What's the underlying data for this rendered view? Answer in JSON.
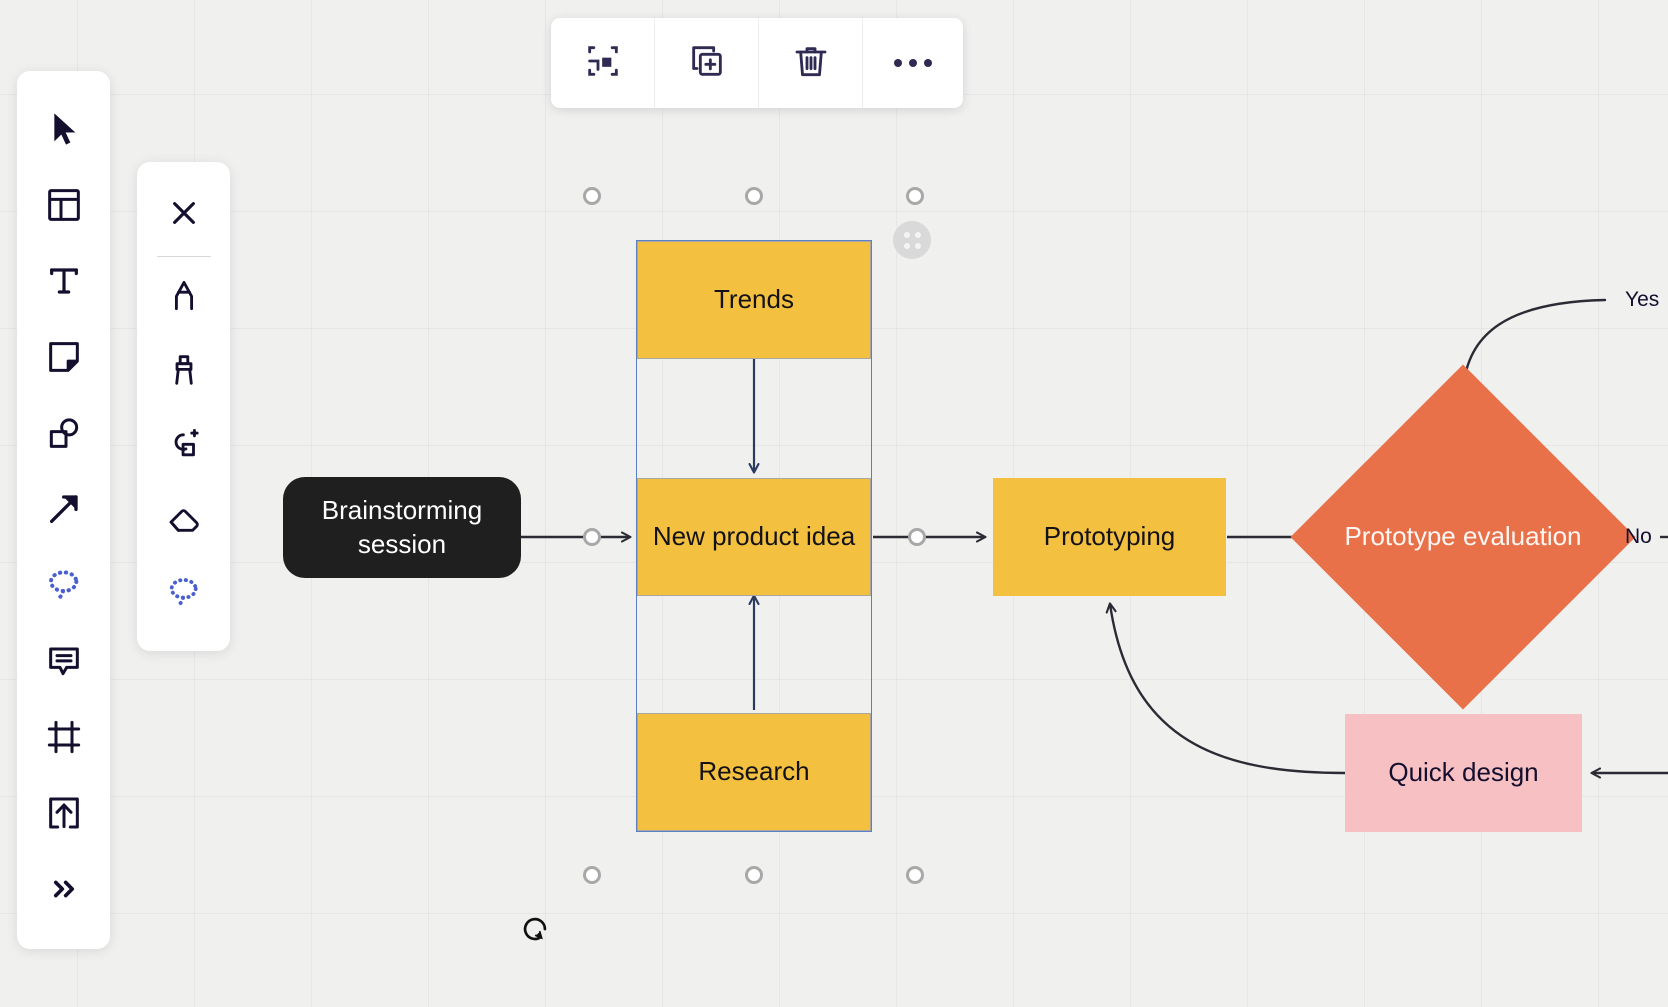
{
  "app": {
    "name": "Whiteboard canvas",
    "background_color": "#f0f0ef",
    "grid_color": "#e4e4e2"
  },
  "context_toolbar": {
    "buttons": [
      {
        "name": "frame-selection",
        "label": "Frame selection",
        "icon": "frame-icon"
      },
      {
        "name": "duplicate",
        "label": "Duplicate",
        "icon": "duplicate-icon"
      },
      {
        "name": "delete",
        "label": "Delete",
        "icon": "trash-icon"
      },
      {
        "name": "more",
        "label": "More options",
        "icon": "ellipsis-icon"
      }
    ]
  },
  "tool_rail": {
    "tools": [
      {
        "name": "select",
        "label": "Select",
        "icon": "cursor-icon"
      },
      {
        "name": "template",
        "label": "Templates",
        "icon": "template-icon"
      },
      {
        "name": "text",
        "label": "Text",
        "icon": "text-icon"
      },
      {
        "name": "sticky-note",
        "label": "Sticky note",
        "icon": "sticky-note-icon"
      },
      {
        "name": "shapes",
        "label": "Shapes",
        "icon": "shapes-icon"
      },
      {
        "name": "connector",
        "label": "Connection line",
        "icon": "arrow-icon"
      },
      {
        "name": "pen",
        "label": "Pen",
        "icon": "lasso-icon"
      },
      {
        "name": "comment",
        "label": "Comment",
        "icon": "comment-icon"
      },
      {
        "name": "frame",
        "label": "Frame",
        "icon": "frame-tool-icon"
      },
      {
        "name": "upload",
        "label": "Upload",
        "icon": "upload-icon"
      },
      {
        "name": "more-tools",
        "label": "More tools",
        "icon": "chevrons-right-icon"
      }
    ]
  },
  "pen_rail": {
    "tools": [
      {
        "name": "close-pen-rail",
        "label": "Close",
        "icon": "close-icon"
      },
      {
        "name": "pen",
        "label": "Pen",
        "icon": "pen-icon"
      },
      {
        "name": "marker",
        "label": "Marker",
        "icon": "marker-icon"
      },
      {
        "name": "smart-draw",
        "label": "Smart drawing",
        "icon": "smart-shape-icon"
      },
      {
        "name": "eraser",
        "label": "Eraser",
        "icon": "eraser-icon"
      },
      {
        "name": "lasso",
        "label": "Lasso select",
        "icon": "lasso-icon"
      }
    ]
  },
  "diagram": {
    "nodes": [
      {
        "id": "brainstorming",
        "label": "Brainstorming session",
        "shape": "rounded-rect",
        "fill": "#201f1f",
        "text_color": "#ffffff"
      },
      {
        "id": "trends",
        "label": "Trends",
        "shape": "rect",
        "fill": "#f3c13f",
        "text_color": "#141218"
      },
      {
        "id": "new-product-idea",
        "label": "New product idea",
        "shape": "rect",
        "fill": "#f3c13f",
        "text_color": "#141218"
      },
      {
        "id": "research",
        "label": "Research",
        "shape": "rect",
        "fill": "#f3c13f",
        "text_color": "#141218"
      },
      {
        "id": "prototyping",
        "label": "Prototyping",
        "shape": "rect",
        "fill": "#f3c13f",
        "text_color": "#141218"
      },
      {
        "id": "prototype-evaluation",
        "label": "Prototype evaluation",
        "shape": "diamond",
        "fill": "#e8714a",
        "text_color": "#fdf6f2"
      },
      {
        "id": "quick-design",
        "label": "Quick design",
        "shape": "rect",
        "fill": "#f7c1c3",
        "text_color": "#140f2e"
      }
    ],
    "edge_labels": [
      {
        "id": "yes",
        "label": "Yes"
      },
      {
        "id": "no",
        "label": "No"
      }
    ],
    "selection": {
      "selected_node": "new-product-idea-group",
      "border_color": "#5b7fc7",
      "handle_count": 6,
      "has_rotate_handle": true,
      "has_drag_handle": true
    }
  }
}
